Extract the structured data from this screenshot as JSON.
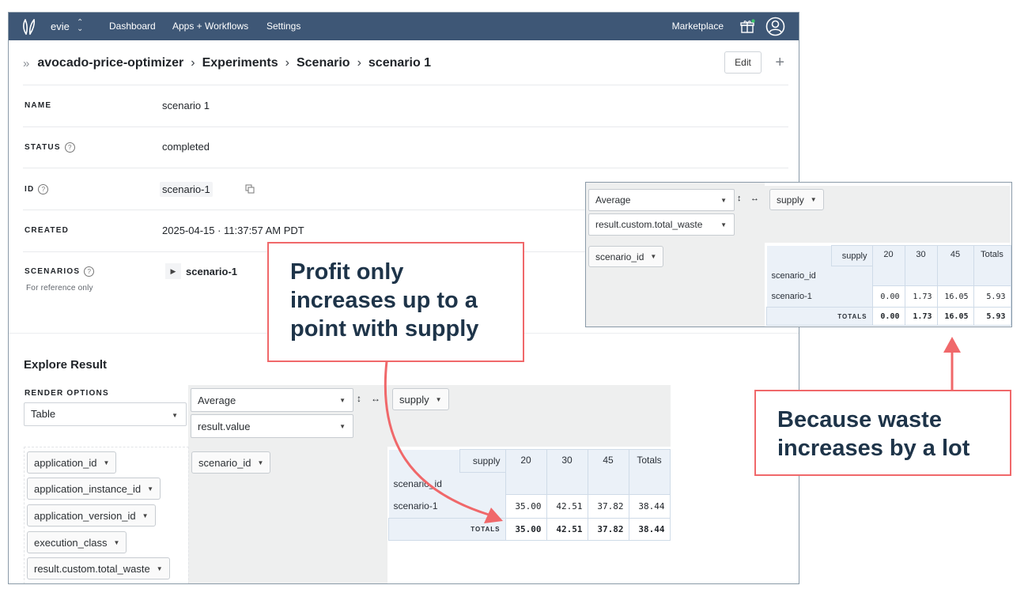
{
  "topbar": {
    "account": "evie",
    "nav": [
      "Dashboard",
      "Apps + Workflows",
      "Settings"
    ],
    "marketplace": "Marketplace"
  },
  "breadcrumb": [
    "avocado-price-optimizer",
    "Experiments",
    "Scenario",
    "scenario 1"
  ],
  "actions": {
    "edit": "Edit",
    "add": "+"
  },
  "details": {
    "name": {
      "label": "NAME",
      "value": "scenario 1"
    },
    "status": {
      "label": "STATUS",
      "value": "completed"
    },
    "id": {
      "label": "ID",
      "value": "scenario-1"
    },
    "created": {
      "label": "CREATED",
      "value": "2025-04-15 · 11:37:57 AM PDT"
    },
    "scenarios": {
      "label": "SCENARIOS",
      "note": "For reference only",
      "value": "scenario-1"
    }
  },
  "explore": {
    "title": "Explore Result",
    "render_label": "RENDER OPTIONS",
    "render_value": "Table",
    "aggregator": "Average",
    "value_field": "result.value",
    "col_attr": "supply",
    "row_attr": "scenario_id",
    "unused_attrs": [
      "application_id",
      "application_instance_id",
      "application_version_id",
      "execution_class",
      "result.custom.total_waste"
    ],
    "table": {
      "col_header": "supply",
      "row_header": "scenario_id",
      "columns": [
        "20",
        "30",
        "45",
        "Totals"
      ],
      "row_label": "scenario-1",
      "row_values": [
        "35.00",
        "42.51",
        "37.82",
        "38.44"
      ],
      "totals_label": "TOTALS",
      "totals_values": [
        "35.00",
        "42.51",
        "37.82",
        "38.44"
      ]
    }
  },
  "waste_panel": {
    "aggregator": "Average",
    "value_field": "result.custom.total_waste",
    "col_attr": "supply",
    "row_attr": "scenario_id",
    "table": {
      "col_header": "supply",
      "row_header": "scenario_id",
      "columns": [
        "20",
        "30",
        "45",
        "Totals"
      ],
      "row_label": "scenario-1",
      "row_values": [
        "0.00",
        "1.73",
        "16.05",
        "5.93"
      ],
      "totals_label": "TOTALS",
      "totals_values": [
        "0.00",
        "1.73",
        "16.05",
        "5.93"
      ]
    }
  },
  "annotations": {
    "profit": [
      "Profit only",
      "increases up to a",
      "point with supply"
    ],
    "waste": [
      "Because waste",
      "increases by a lot"
    ]
  },
  "colors": {
    "topbar": "#3e5776",
    "callout_border": "#f0686a",
    "callout_text": "#1e3449",
    "table_header": "#ebf1f8"
  }
}
